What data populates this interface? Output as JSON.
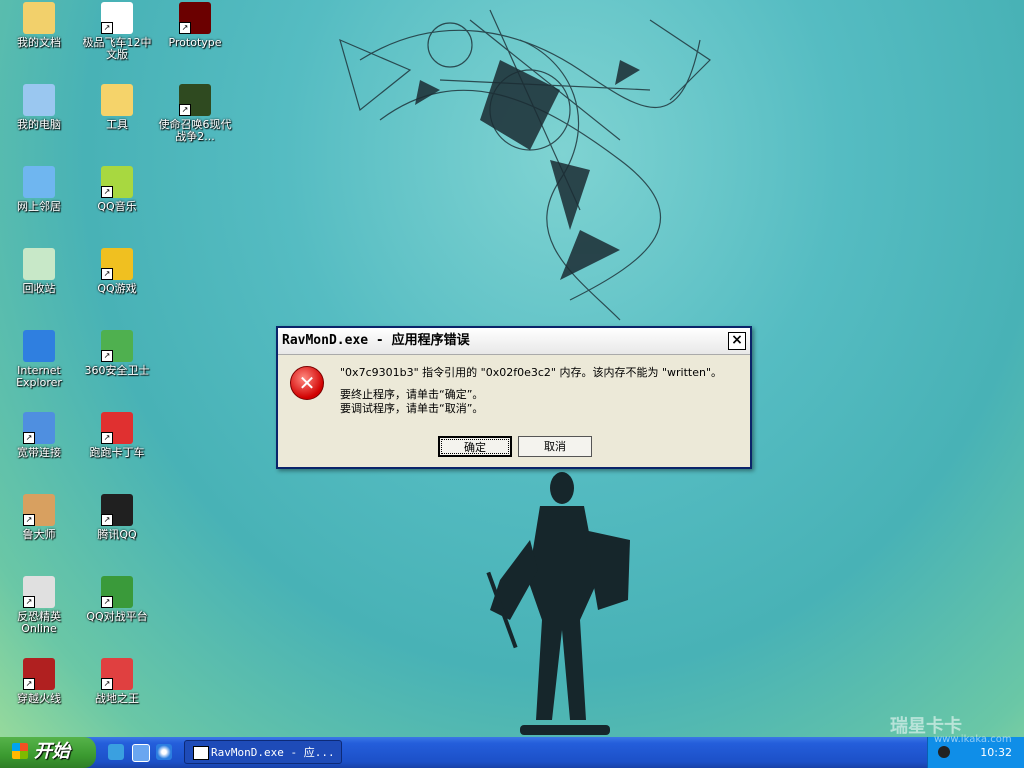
{
  "desktop": {
    "icons": [
      {
        "label": "我的文档",
        "icon": "my-documents-icon"
      },
      {
        "label": "极品飞车12中文版",
        "icon": "nfs-icon"
      },
      {
        "label": "Prototype",
        "icon": "prototype-icon"
      },
      {
        "label": "我的电脑",
        "icon": "my-computer-icon"
      },
      {
        "label": "工具",
        "icon": "folder-icon"
      },
      {
        "label": "使命召唤6现代战争2...",
        "icon": "cod-icon"
      },
      {
        "label": "网上邻居",
        "icon": "network-icon"
      },
      {
        "label": "QQ音乐",
        "icon": "qq-music-icon"
      },
      {
        "label": "回收站",
        "icon": "recycle-bin-icon"
      },
      {
        "label": "QQ游戏",
        "icon": "qq-game-icon"
      },
      {
        "label": "Internet Explorer",
        "icon": "ie-icon"
      },
      {
        "label": "360安全卫士",
        "icon": "360-icon"
      },
      {
        "label": "宽带连接",
        "icon": "broadband-icon"
      },
      {
        "label": "跑跑卡丁车",
        "icon": "kart-icon"
      },
      {
        "label": "鲁大师",
        "icon": "ludashi-icon"
      },
      {
        "label": "腾讯QQ",
        "icon": "qq-icon"
      },
      {
        "label": "反恐精英Online",
        "icon": "cs-icon"
      },
      {
        "label": "QQ对战平台",
        "icon": "qq-battle-icon"
      },
      {
        "label": "穿越火线",
        "icon": "crossfire-icon"
      },
      {
        "label": "战地之王",
        "icon": "ava-icon"
      }
    ]
  },
  "dialog": {
    "title": "RavMonD.exe - 应用程序错误",
    "message": "\"0x7c9301b3\" 指令引用的 \"0x02f0e3c2\" 内存。该内存不能为 \"written\"。",
    "line2": "要终止程序，请单击“确定”。",
    "line3": "要调试程序，请单击“取消”。",
    "ok_label": "确定",
    "cancel_label": "取消",
    "close_label": "×",
    "error_icon": "error-x-icon"
  },
  "taskbar": {
    "start_label": "开始",
    "task_label": "RavMonD.exe - 应...",
    "clock": "10:32"
  },
  "watermark": {
    "text": "瑞星卡卡",
    "sub": "www.ikaka.com"
  },
  "colors": {
    "taskbar_blue": "#245edb",
    "start_green": "#3b9a30",
    "dialog_face": "#ece9d8",
    "error_red": "#d10000"
  }
}
